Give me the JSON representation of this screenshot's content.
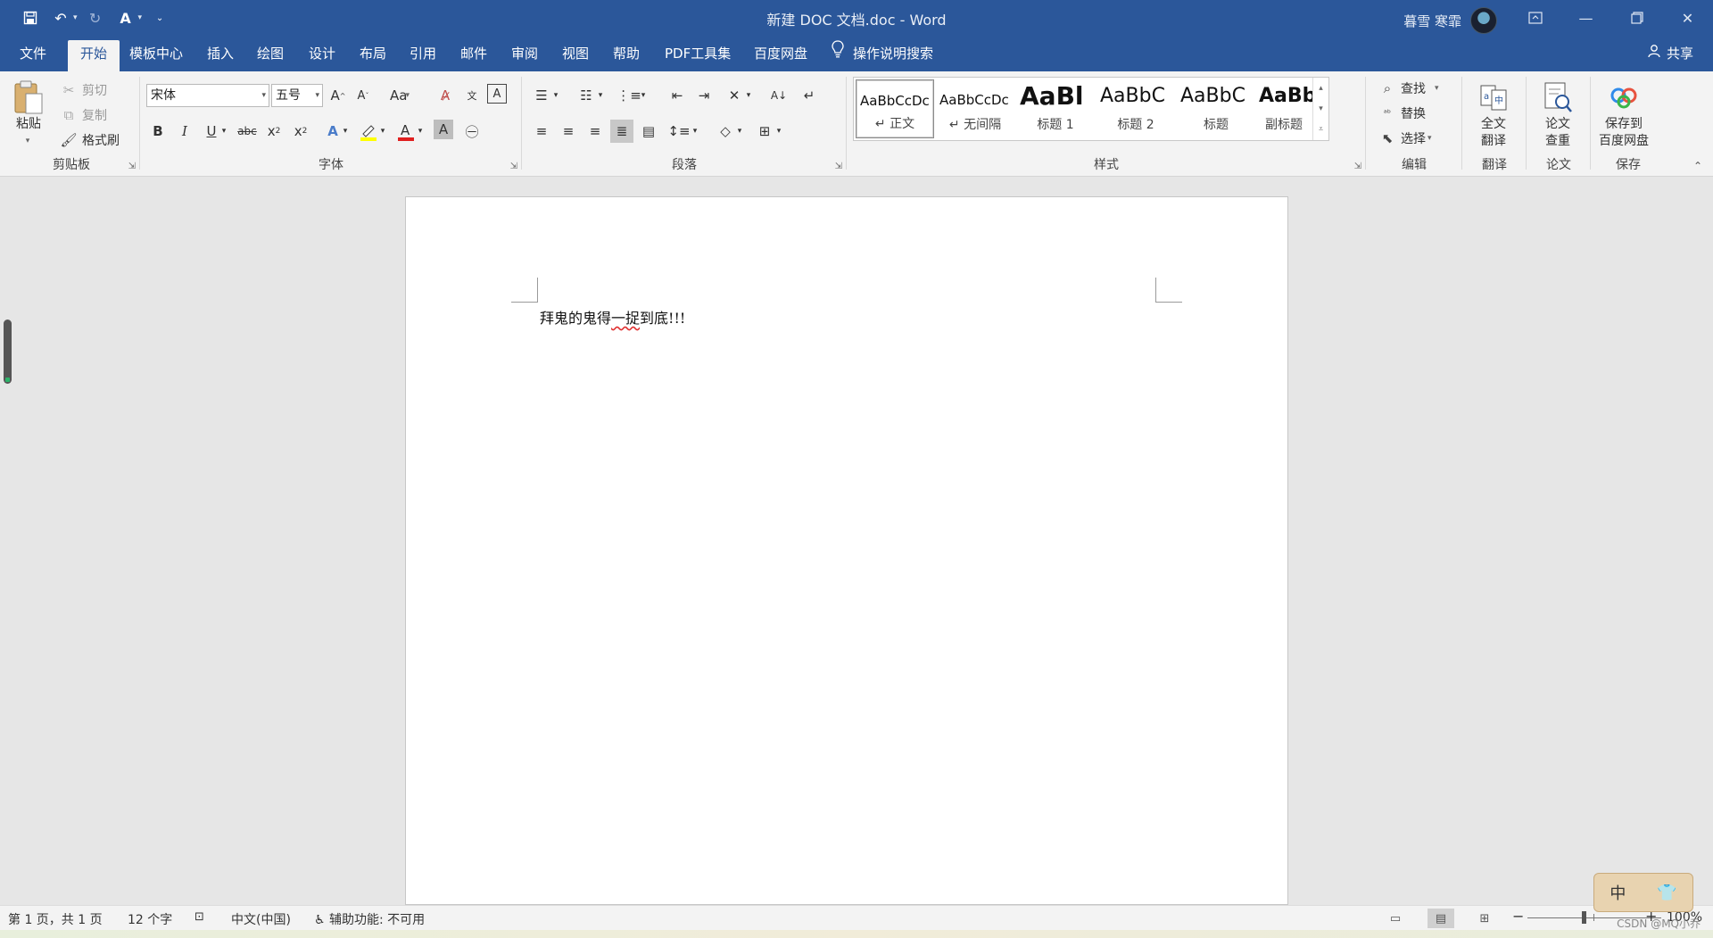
{
  "titlebar": {
    "doc_title": "新建 DOC 文档.doc  -  Word",
    "user_name": "暮雪 寒霏"
  },
  "tabs": [
    {
      "label": "文件"
    },
    {
      "label": "开始"
    },
    {
      "label": "模板中心"
    },
    {
      "label": "插入"
    },
    {
      "label": "绘图"
    },
    {
      "label": "设计"
    },
    {
      "label": "布局"
    },
    {
      "label": "引用"
    },
    {
      "label": "邮件"
    },
    {
      "label": "审阅"
    },
    {
      "label": "视图"
    },
    {
      "label": "帮助"
    },
    {
      "label": "PDF工具集"
    },
    {
      "label": "百度网盘"
    }
  ],
  "active_tab": "开始",
  "tell_me": "操作说明搜索",
  "share": "共享",
  "clipboard": {
    "paste": "粘贴",
    "cut": "剪切",
    "copy": "复制",
    "format_painter": "格式刷",
    "label": "剪贴板"
  },
  "font": {
    "name": "宋体",
    "size": "五号",
    "label": "字体"
  },
  "paragraph": {
    "label": "段落"
  },
  "styles": {
    "label": "样式",
    "items": [
      {
        "sample": "AaBbCcDc",
        "name": "↵ 正文"
      },
      {
        "sample": "AaBbCcDc",
        "name": "↵ 无间隔"
      },
      {
        "sample": "AaBl",
        "name": "标题 1"
      },
      {
        "sample": "AaBbC",
        "name": "标题 2"
      },
      {
        "sample": "AaBbC",
        "name": "标题"
      },
      {
        "sample": "AaBbC",
        "name": "副标题"
      }
    ]
  },
  "editing": {
    "find": "查找",
    "replace": "替换",
    "select": "选择",
    "label": "编辑"
  },
  "translate": {
    "button": [
      "全文",
      "翻译"
    ],
    "label": "翻译"
  },
  "paper": {
    "button": [
      "论文",
      "查重"
    ],
    "label": "论文"
  },
  "save": {
    "button": [
      "保存到",
      "百度网盘"
    ],
    "label": "保存"
  },
  "document": {
    "text_before": "拜鬼的鬼得",
    "text_underlined": "一捉",
    "text_after": "到底!!!"
  },
  "status": {
    "page": "第 1 页，共 1 页",
    "words": "12 个字",
    "language": "中文(中国)",
    "accessibility": "辅助功能: 不可用",
    "zoom": "100%"
  },
  "ime": {
    "mode": "中"
  },
  "watermark": "CSDN @MQ小乔"
}
